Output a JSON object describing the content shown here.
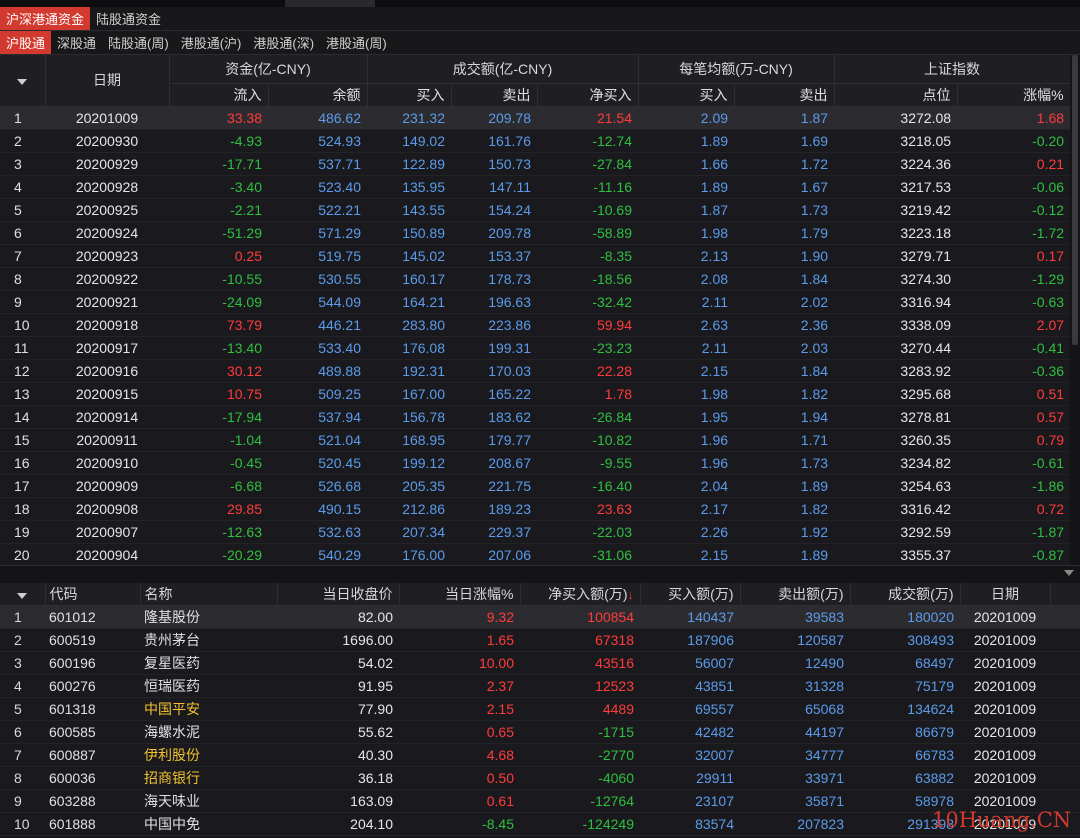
{
  "tabs_level1": [
    {
      "label": "沪深港通资金",
      "active": true
    },
    {
      "label": "陆股通资金",
      "active": false
    }
  ],
  "tabs_level2": [
    {
      "label": "沪股通",
      "active": true
    },
    {
      "label": "深股通",
      "active": false
    },
    {
      "label": "陆股通(周)",
      "active": false
    },
    {
      "label": "港股通(沪)",
      "active": false
    },
    {
      "label": "港股通(深)",
      "active": false
    },
    {
      "label": "港股通(周)",
      "active": false
    }
  ],
  "upper_table": {
    "group_headers": {
      "date": "日期",
      "capital": "资金(亿-CNY)",
      "turnover": "成交额(亿-CNY)",
      "avg": "每笔均额(万-CNY)",
      "index": "上证指数"
    },
    "sub_headers": {
      "inflow": "流入",
      "balance": "余额",
      "buy": "买入",
      "sell": "卖出",
      "net": "净买入",
      "avg_buy": "买入",
      "avg_sell": "卖出",
      "points": "点位",
      "change": "涨幅%"
    },
    "rows": [
      {
        "idx": "1",
        "date": "20201009",
        "inflow": "33.38",
        "balance": "486.62",
        "buy": "231.32",
        "sell": "209.78",
        "net": "21.54",
        "avg_buy": "2.09",
        "avg_sell": "1.87",
        "points": "3272.08",
        "change": "1.68"
      },
      {
        "idx": "2",
        "date": "20200930",
        "inflow": "-4.93",
        "balance": "524.93",
        "buy": "149.02",
        "sell": "161.76",
        "net": "-12.74",
        "avg_buy": "1.89",
        "avg_sell": "1.69",
        "points": "3218.05",
        "change": "-0.20"
      },
      {
        "idx": "3",
        "date": "20200929",
        "inflow": "-17.71",
        "balance": "537.71",
        "buy": "122.89",
        "sell": "150.73",
        "net": "-27.84",
        "avg_buy": "1.66",
        "avg_sell": "1.72",
        "points": "3224.36",
        "change": "0.21"
      },
      {
        "idx": "4",
        "date": "20200928",
        "inflow": "-3.40",
        "balance": "523.40",
        "buy": "135.95",
        "sell": "147.11",
        "net": "-11.16",
        "avg_buy": "1.89",
        "avg_sell": "1.67",
        "points": "3217.53",
        "change": "-0.06"
      },
      {
        "idx": "5",
        "date": "20200925",
        "inflow": "-2.21",
        "balance": "522.21",
        "buy": "143.55",
        "sell": "154.24",
        "net": "-10.69",
        "avg_buy": "1.87",
        "avg_sell": "1.73",
        "points": "3219.42",
        "change": "-0.12"
      },
      {
        "idx": "6",
        "date": "20200924",
        "inflow": "-51.29",
        "balance": "571.29",
        "buy": "150.89",
        "sell": "209.78",
        "net": "-58.89",
        "avg_buy": "1.98",
        "avg_sell": "1.79",
        "points": "3223.18",
        "change": "-1.72"
      },
      {
        "idx": "7",
        "date": "20200923",
        "inflow": "0.25",
        "balance": "519.75",
        "buy": "145.02",
        "sell": "153.37",
        "net": "-8.35",
        "avg_buy": "2.13",
        "avg_sell": "1.90",
        "points": "3279.71",
        "change": "0.17"
      },
      {
        "idx": "8",
        "date": "20200922",
        "inflow": "-10.55",
        "balance": "530.55",
        "buy": "160.17",
        "sell": "178.73",
        "net": "-18.56",
        "avg_buy": "2.08",
        "avg_sell": "1.84",
        "points": "3274.30",
        "change": "-1.29"
      },
      {
        "idx": "9",
        "date": "20200921",
        "inflow": "-24.09",
        "balance": "544.09",
        "buy": "164.21",
        "sell": "196.63",
        "net": "-32.42",
        "avg_buy": "2.11",
        "avg_sell": "2.02",
        "points": "3316.94",
        "change": "-0.63"
      },
      {
        "idx": "10",
        "date": "20200918",
        "inflow": "73.79",
        "balance": "446.21",
        "buy": "283.80",
        "sell": "223.86",
        "net": "59.94",
        "avg_buy": "2.63",
        "avg_sell": "2.36",
        "points": "3338.09",
        "change": "2.07"
      },
      {
        "idx": "11",
        "date": "20200917",
        "inflow": "-13.40",
        "balance": "533.40",
        "buy": "176.08",
        "sell": "199.31",
        "net": "-23.23",
        "avg_buy": "2.11",
        "avg_sell": "2.03",
        "points": "3270.44",
        "change": "-0.41"
      },
      {
        "idx": "12",
        "date": "20200916",
        "inflow": "30.12",
        "balance": "489.88",
        "buy": "192.31",
        "sell": "170.03",
        "net": "22.28",
        "avg_buy": "2.15",
        "avg_sell": "1.84",
        "points": "3283.92",
        "change": "-0.36"
      },
      {
        "idx": "13",
        "date": "20200915",
        "inflow": "10.75",
        "balance": "509.25",
        "buy": "167.00",
        "sell": "165.22",
        "net": "1.78",
        "avg_buy": "1.98",
        "avg_sell": "1.82",
        "points": "3295.68",
        "change": "0.51"
      },
      {
        "idx": "14",
        "date": "20200914",
        "inflow": "-17.94",
        "balance": "537.94",
        "buy": "156.78",
        "sell": "183.62",
        "net": "-26.84",
        "avg_buy": "1.95",
        "avg_sell": "1.94",
        "points": "3278.81",
        "change": "0.57"
      },
      {
        "idx": "15",
        "date": "20200911",
        "inflow": "-1.04",
        "balance": "521.04",
        "buy": "168.95",
        "sell": "179.77",
        "net": "-10.82",
        "avg_buy": "1.96",
        "avg_sell": "1.71",
        "points": "3260.35",
        "change": "0.79"
      },
      {
        "idx": "16",
        "date": "20200910",
        "inflow": "-0.45",
        "balance": "520.45",
        "buy": "199.12",
        "sell": "208.67",
        "net": "-9.55",
        "avg_buy": "1.96",
        "avg_sell": "1.73",
        "points": "3234.82",
        "change": "-0.61"
      },
      {
        "idx": "17",
        "date": "20200909",
        "inflow": "-6.68",
        "balance": "526.68",
        "buy": "205.35",
        "sell": "221.75",
        "net": "-16.40",
        "avg_buy": "2.04",
        "avg_sell": "1.89",
        "points": "3254.63",
        "change": "-1.86"
      },
      {
        "idx": "18",
        "date": "20200908",
        "inflow": "29.85",
        "balance": "490.15",
        "buy": "212.86",
        "sell": "189.23",
        "net": "23.63",
        "avg_buy": "2.17",
        "avg_sell": "1.82",
        "points": "3316.42",
        "change": "0.72"
      },
      {
        "idx": "19",
        "date": "20200907",
        "inflow": "-12.63",
        "balance": "532.63",
        "buy": "207.34",
        "sell": "229.37",
        "net": "-22.03",
        "avg_buy": "2.26",
        "avg_sell": "1.92",
        "points": "3292.59",
        "change": "-1.87"
      },
      {
        "idx": "20",
        "date": "20200904",
        "inflow": "-20.29",
        "balance": "540.29",
        "buy": "176.00",
        "sell": "207.06",
        "net": "-31.06",
        "avg_buy": "2.15",
        "avg_sell": "1.89",
        "points": "3355.37",
        "change": "-0.87"
      }
    ]
  },
  "lower_table": {
    "headers": {
      "code": "代码",
      "name": "名称",
      "close": "当日收盘价",
      "change": "当日涨幅%",
      "net": "净买入额(万)",
      "buy": "买入额(万)",
      "sell": "卖出额(万)",
      "turnover": "成交额(万)",
      "date": "日期"
    },
    "sort_indicator": "↓",
    "rows": [
      {
        "idx": "1",
        "code": "601012",
        "name": "隆基股份",
        "highlight": false,
        "close": "82.00",
        "change": "9.32",
        "net": "100854",
        "buy": "140437",
        "sell": "39583",
        "turnover": "180020",
        "date": "20201009"
      },
      {
        "idx": "2",
        "code": "600519",
        "name": "贵州茅台",
        "highlight": false,
        "close": "1696.00",
        "change": "1.65",
        "net": "67318",
        "buy": "187906",
        "sell": "120587",
        "turnover": "308493",
        "date": "20201009"
      },
      {
        "idx": "3",
        "code": "600196",
        "name": "复星医药",
        "highlight": false,
        "close": "54.02",
        "change": "10.00",
        "net": "43516",
        "buy": "56007",
        "sell": "12490",
        "turnover": "68497",
        "date": "20201009"
      },
      {
        "idx": "4",
        "code": "600276",
        "name": "恒瑞医药",
        "highlight": false,
        "close": "91.95",
        "change": "2.37",
        "net": "12523",
        "buy": "43851",
        "sell": "31328",
        "turnover": "75179",
        "date": "20201009"
      },
      {
        "idx": "5",
        "code": "601318",
        "name": "中国平安",
        "highlight": true,
        "close": "77.90",
        "change": "2.15",
        "net": "4489",
        "buy": "69557",
        "sell": "65068",
        "turnover": "134624",
        "date": "20201009"
      },
      {
        "idx": "6",
        "code": "600585",
        "name": "海螺水泥",
        "highlight": false,
        "close": "55.62",
        "change": "0.65",
        "net": "-1715",
        "buy": "42482",
        "sell": "44197",
        "turnover": "86679",
        "date": "20201009"
      },
      {
        "idx": "7",
        "code": "600887",
        "name": "伊利股份",
        "highlight": true,
        "close": "40.30",
        "change": "4.68",
        "net": "-2770",
        "buy": "32007",
        "sell": "34777",
        "turnover": "66783",
        "date": "20201009"
      },
      {
        "idx": "8",
        "code": "600036",
        "name": "招商银行",
        "highlight": true,
        "close": "36.18",
        "change": "0.50",
        "net": "-4060",
        "buy": "29911",
        "sell": "33971",
        "turnover": "63882",
        "date": "20201009"
      },
      {
        "idx": "9",
        "code": "603288",
        "name": "海天味业",
        "highlight": false,
        "close": "163.09",
        "change": "0.61",
        "net": "-12764",
        "buy": "23107",
        "sell": "35871",
        "turnover": "58978",
        "date": "20201009"
      },
      {
        "idx": "10",
        "code": "601888",
        "name": "中国中免",
        "highlight": false,
        "close": "204.10",
        "change": "-8.45",
        "net": "-124249",
        "buy": "83574",
        "sell": "207823",
        "turnover": "291398",
        "date": "20201009"
      }
    ]
  },
  "watermark": "10Huang.CN",
  "colors": {
    "up": "#ff3b3b",
    "down": "#2fbf3f",
    "neutral": "#5b9bea",
    "accent": "#d33a2f",
    "highlight_name": "#f2c230"
  },
  "icons": {
    "menu": "triangle-down-icon",
    "collapse": "triangle-down-icon"
  }
}
